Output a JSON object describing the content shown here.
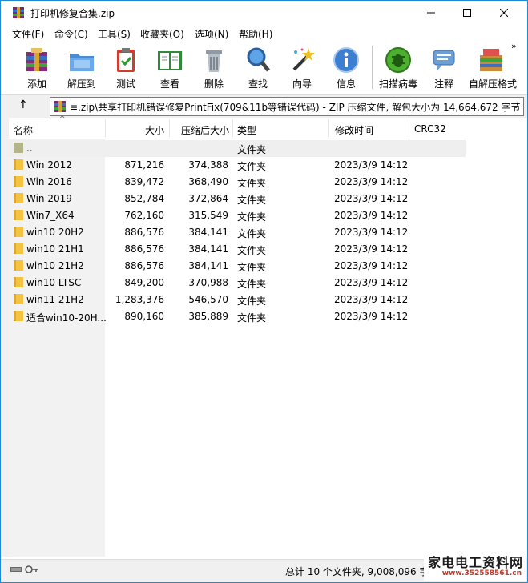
{
  "window": {
    "title": "打印机修复合集.zip"
  },
  "menu": [
    "文件(F)",
    "命令(C)",
    "工具(S)",
    "收藏夹(O)",
    "选项(N)",
    "帮助(H)"
  ],
  "toolbar": [
    {
      "label": "添加",
      "icon": "add-archive-icon"
    },
    {
      "label": "解压到",
      "icon": "extract-folder-icon"
    },
    {
      "label": "测试",
      "icon": "test-clipboard-icon"
    },
    {
      "label": "查看",
      "icon": "view-book-icon"
    },
    {
      "label": "删除",
      "icon": "delete-trash-icon"
    },
    {
      "label": "查找",
      "icon": "find-magnifier-icon"
    },
    {
      "label": "向导",
      "icon": "wizard-wand-icon"
    },
    {
      "label": "信息",
      "icon": "info-icon"
    },
    {
      "label": "扫描病毒",
      "icon": "scan-virus-icon"
    },
    {
      "label": "注释",
      "icon": "comment-icon"
    },
    {
      "label": "自解压格式",
      "icon": "sfx-box-icon"
    }
  ],
  "address": {
    "text": "≡.zip\\共享打印机错误修复PrintFix(709&11b等错误代码) - ZIP 压缩文件, 解包大小为 14,664,672 字节"
  },
  "columns": {
    "name": "名称",
    "size": "大小",
    "packed": "压缩后大小",
    "type": "类型",
    "modified": "修改时间",
    "crc": "CRC32"
  },
  "rows": [
    {
      "name": "..",
      "size": "",
      "packed": "",
      "type": "文件夹",
      "modified": ""
    },
    {
      "name": "Win 2012",
      "size": "871,216",
      "packed": "374,388",
      "type": "文件夹",
      "modified": "2023/3/9 14:12"
    },
    {
      "name": "Win 2016",
      "size": "839,472",
      "packed": "368,490",
      "type": "文件夹",
      "modified": "2023/3/9 14:12"
    },
    {
      "name": "Win 2019",
      "size": "852,784",
      "packed": "372,864",
      "type": "文件夹",
      "modified": "2023/3/9 14:12"
    },
    {
      "name": "Win7_X64",
      "size": "762,160",
      "packed": "315,549",
      "type": "文件夹",
      "modified": "2023/3/9 14:12"
    },
    {
      "name": "win10 20H2",
      "size": "886,576",
      "packed": "384,141",
      "type": "文件夹",
      "modified": "2023/3/9 14:12"
    },
    {
      "name": "win10 21H1",
      "size": "886,576",
      "packed": "384,141",
      "type": "文件夹",
      "modified": "2023/3/9 14:12"
    },
    {
      "name": "win10 21H2",
      "size": "886,576",
      "packed": "384,141",
      "type": "文件夹",
      "modified": "2023/3/9 14:12"
    },
    {
      "name": "win10 LTSC",
      "size": "849,200",
      "packed": "370,988",
      "type": "文件夹",
      "modified": "2023/3/9 14:12"
    },
    {
      "name": "win11 21H2",
      "size": "1,283,376",
      "packed": "546,570",
      "type": "文件夹",
      "modified": "2023/3/9 14:12"
    },
    {
      "name": "适合win10-20H...",
      "size": "890,160",
      "packed": "385,889",
      "type": "文件夹",
      "modified": "2023/3/9 14:12"
    }
  ],
  "status": {
    "text": "总计 10 个文件夹, 9,008,096 字节"
  },
  "watermark": {
    "title": "家电电工资料网",
    "url": "www.352558561.cn"
  },
  "colors": {
    "folder": "#f5c342",
    "parent_folder": "#b5b58c",
    "window_border": "#1e8bd6"
  }
}
